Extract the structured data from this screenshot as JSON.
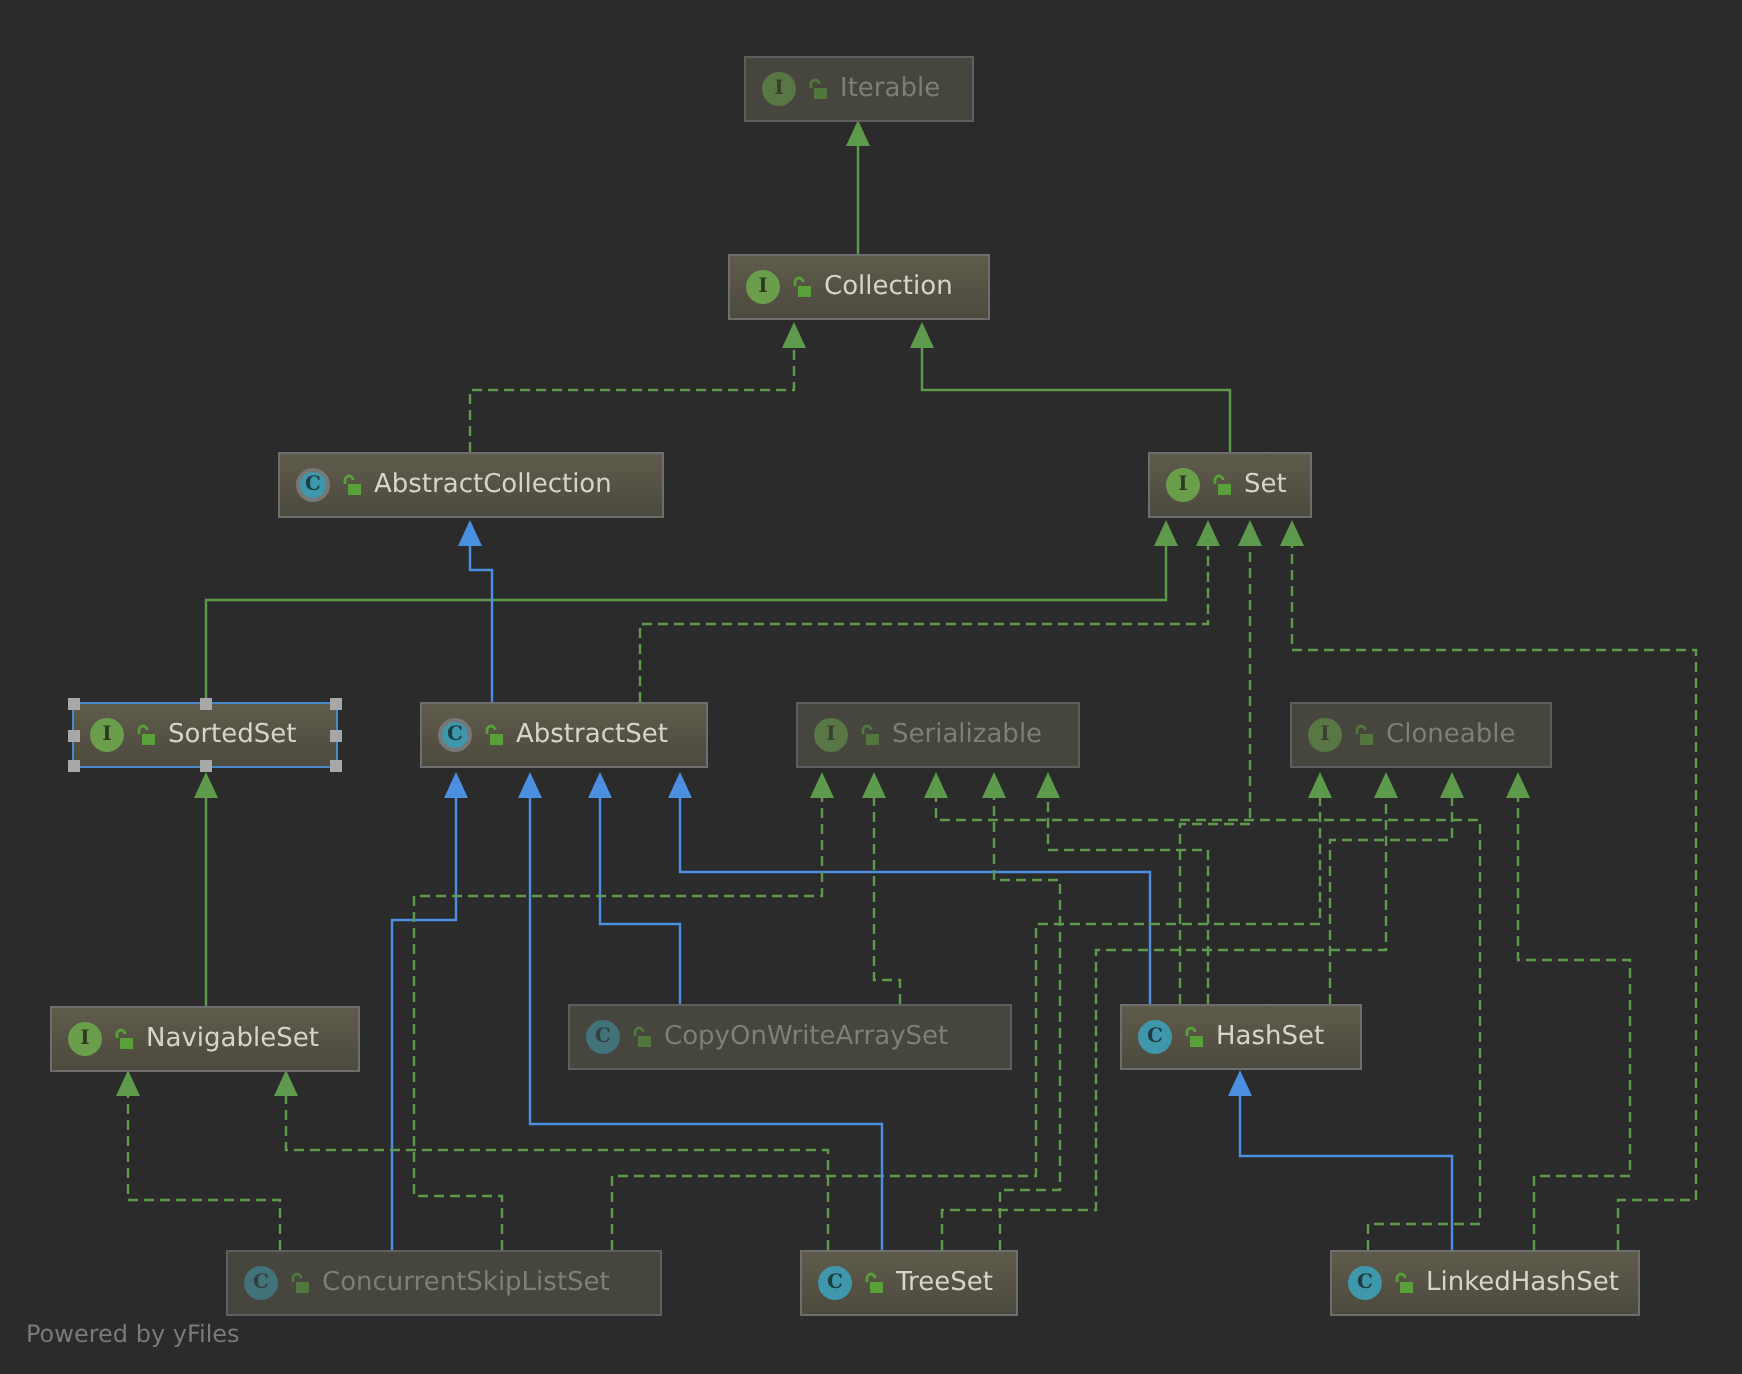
{
  "diagram": {
    "nodes": [
      {
        "name": "Iterable",
        "kind": "interface",
        "badge": "I",
        "dimmed": true,
        "selected": false
      },
      {
        "name": "Collection",
        "kind": "interface",
        "badge": "I",
        "dimmed": false,
        "selected": false
      },
      {
        "name": "AbstractCollection",
        "kind": "abstract",
        "badge": "C",
        "dimmed": false,
        "selected": false
      },
      {
        "name": "Set",
        "kind": "interface",
        "badge": "I",
        "dimmed": false,
        "selected": false
      },
      {
        "name": "SortedSet",
        "kind": "interface",
        "badge": "I",
        "dimmed": false,
        "selected": true
      },
      {
        "name": "AbstractSet",
        "kind": "abstract",
        "badge": "C",
        "dimmed": false,
        "selected": false
      },
      {
        "name": "Serializable",
        "kind": "interface",
        "badge": "I",
        "dimmed": true,
        "selected": false
      },
      {
        "name": "Cloneable",
        "kind": "interface",
        "badge": "I",
        "dimmed": true,
        "selected": false
      },
      {
        "name": "NavigableSet",
        "kind": "interface",
        "badge": "I",
        "dimmed": false,
        "selected": false
      },
      {
        "name": "CopyOnWriteArraySet",
        "kind": "class",
        "badge": "C",
        "dimmed": true,
        "selected": false
      },
      {
        "name": "HashSet",
        "kind": "class",
        "badge": "C",
        "dimmed": false,
        "selected": false
      },
      {
        "name": "ConcurrentSkipListSet",
        "kind": "class",
        "badge": "C",
        "dimmed": true,
        "selected": false
      },
      {
        "name": "TreeSet",
        "kind": "class",
        "badge": "C",
        "dimmed": false,
        "selected": false
      },
      {
        "name": "LinkedHashSet",
        "kind": "class",
        "badge": "C",
        "dimmed": false,
        "selected": false
      }
    ],
    "edges": [
      {
        "kind": "extends-interface"
      },
      {
        "kind": "implements"
      },
      {
        "kind": "extends-interface"
      },
      {
        "kind": "extends-interface"
      },
      {
        "kind": "extends-class"
      },
      {
        "kind": "implements"
      },
      {
        "kind": "extends-interface"
      },
      {
        "kind": "extends-class"
      },
      {
        "kind": "implements"
      },
      {
        "kind": "extends-class"
      },
      {
        "kind": "implements"
      },
      {
        "kind": "implements"
      },
      {
        "kind": "implements"
      },
      {
        "kind": "extends-class"
      },
      {
        "kind": "implements"
      },
      {
        "kind": "implements"
      },
      {
        "kind": "implements"
      },
      {
        "kind": "extends-class"
      },
      {
        "kind": "implements"
      },
      {
        "kind": "implements"
      },
      {
        "kind": "implements"
      },
      {
        "kind": "extends-class"
      },
      {
        "kind": "implements"
      },
      {
        "kind": "implements"
      },
      {
        "kind": "implements"
      }
    ]
  },
  "footer": "Powered by yFiles"
}
